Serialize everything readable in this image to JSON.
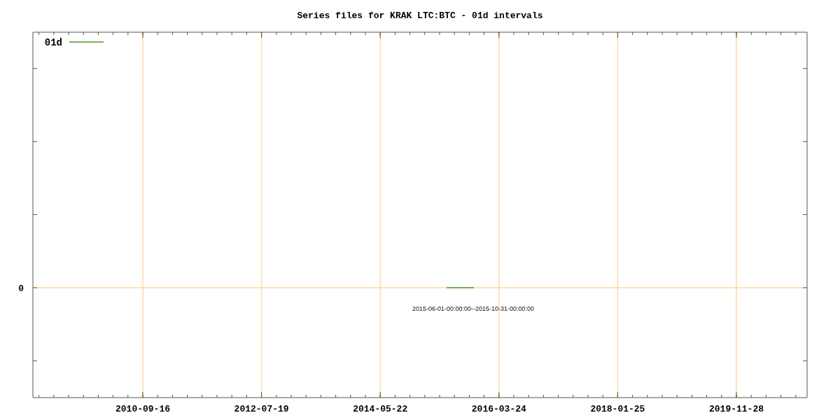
{
  "plot": {
    "title": "Series files for KRAK LTC:BTC - 01d intervals",
    "legend": [
      "01d"
    ],
    "x_axis_labels": [
      "2010-09-16",
      "2012-07-19",
      "2014-05-22",
      "2016-03-24",
      "2018-01-25",
      "2019-11-28"
    ],
    "y_axis_labels": [
      "0"
    ],
    "note": "2015-06-01-00:00:00--2015-10-31-00:00:00"
  }
}
